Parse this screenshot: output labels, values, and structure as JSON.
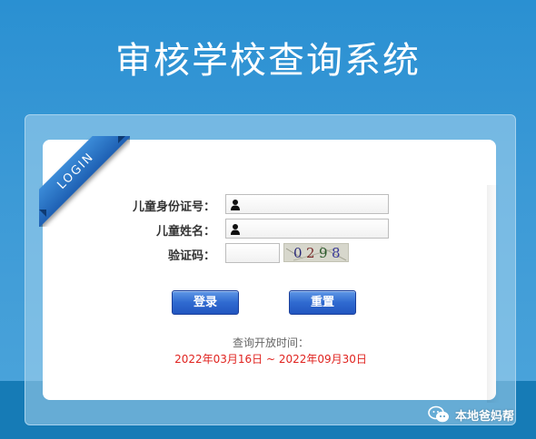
{
  "page": {
    "title": "审核学校查询系统"
  },
  "ribbon": {
    "label": "LOGIN"
  },
  "form": {
    "id_label": "儿童身份证号：",
    "id_value": "",
    "name_label": "儿童姓名：",
    "name_value": "",
    "captcha_label": "验证码：",
    "captcha_value": "",
    "captcha_digits": [
      "0",
      "2",
      "9",
      "8"
    ],
    "login_button": "登录",
    "reset_button": "重置"
  },
  "query_period": {
    "label": "查询开放时间：",
    "value": "2022年03月16日 ~ 2022年09月30日"
  },
  "watermark": {
    "text": "本地爸妈帮",
    "icon": "wechat-icon"
  },
  "colors": {
    "background": "#2f8ecf",
    "button": "#2f6ad0",
    "period_value": "#e0231f"
  }
}
